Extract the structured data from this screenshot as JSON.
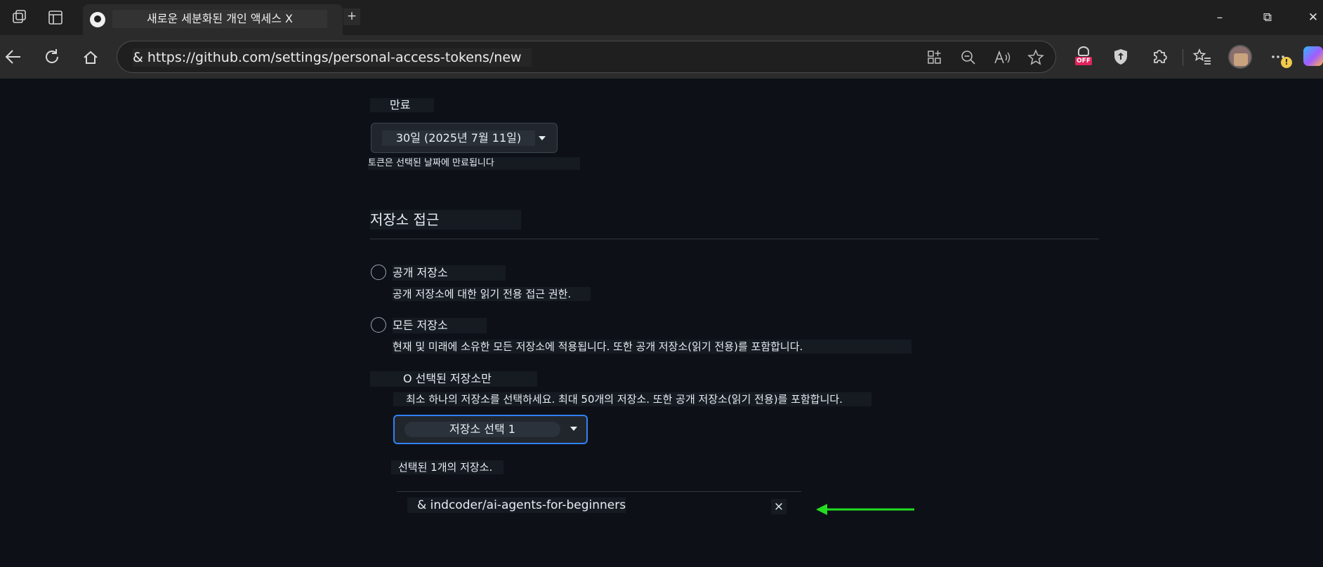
{
  "browser": {
    "tab_title": "새로운 세분화된 개인 액세스 X",
    "new_tab": "+",
    "address": "& https://github.com/settings/personal-access-tokens/new",
    "ext_off_badge": "OFF",
    "warning_badge": "!",
    "controls": {
      "minimize": "–",
      "restore": "⧉",
      "close": "✕"
    }
  },
  "expiration": {
    "label": "만료",
    "selected": "30일 (2025년 7월 11일)",
    "help": "토큰은 선택된 날짜에 만료됩니다"
  },
  "repo_access": {
    "heading": "저장소 접근",
    "options": [
      {
        "label": "공개 저장소",
        "desc": "공개 저장소에 대한 읽기 전용 접근 권한."
      },
      {
        "label": "모든 저장소",
        "desc": "현재 및 미래에 소유한 모든 저장소에 적용됩니다. 또한 공개 저장소(읽기 전용)를 포함합니다."
      },
      {
        "label": "O 선택된 저장소만",
        "desc": "최소 하나의 저장소를 선택하세요. 최대 50개의 저장소. 또한 공개 저장소(읽기 전용)를 포함합니다."
      }
    ],
    "select_button": "저장소 선택 1",
    "selected_count": "선택된 1개의 저장소.",
    "selected_repos": [
      "& indcoder/ai-agents-for-beginners"
    ],
    "remove": "×"
  },
  "colors": {
    "arrow": "#22dd22",
    "accent": "#2f81f7"
  }
}
